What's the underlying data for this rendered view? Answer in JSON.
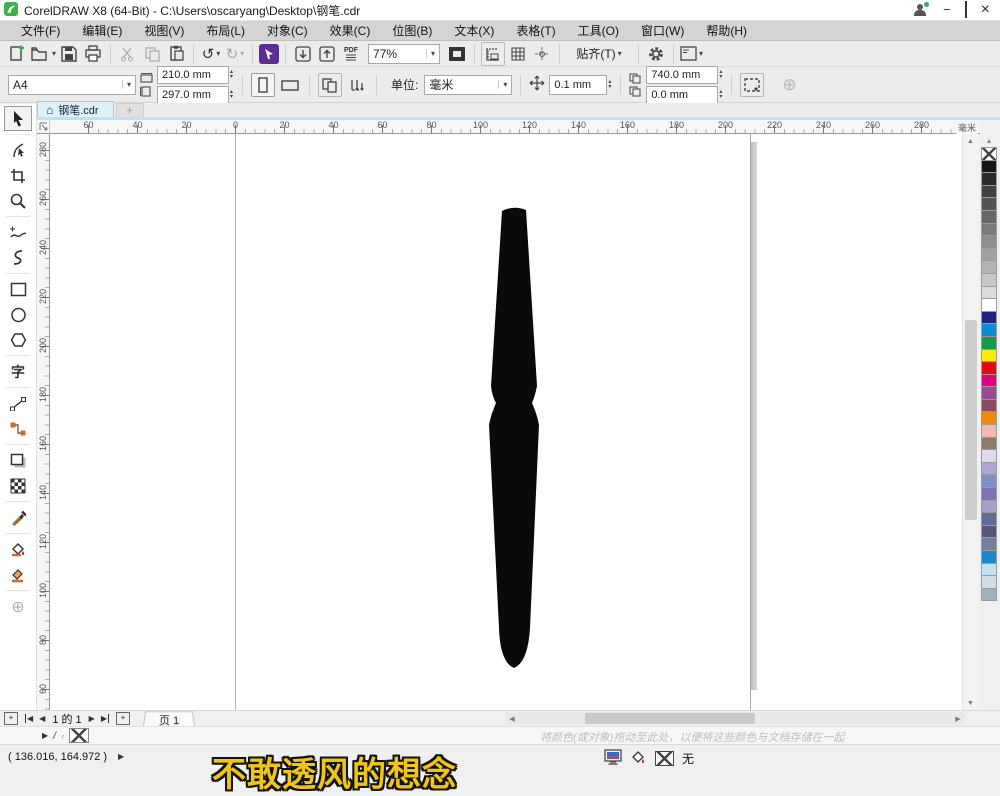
{
  "window": {
    "title": "CorelDRAW X8 (64-Bit) - C:\\Users\\oscaryang\\Desktop\\钢笔.cdr"
  },
  "icons": {
    "minimize": "−",
    "close": "×",
    "dropdown": "▾",
    "spin_up": "▴",
    "spin_down": "▾",
    "scroll_up": "▲",
    "scroll_down": "▼",
    "scroll_left": "◀",
    "scroll_right": "▶",
    "nav_prev": "◀",
    "nav_next": "▶",
    "tab_plus": "+",
    "page_add": "+",
    "import": "↓",
    "export": "↑",
    "undo": "↺",
    "redo": "↻",
    "customize_plus": "⊕",
    "home": "⌂",
    "flyout": "▶",
    "chevron_left": "‹"
  },
  "menubar": {
    "items": [
      "文件(F)",
      "编辑(E)",
      "视图(V)",
      "布局(L)",
      "对象(C)",
      "效果(C)",
      "位图(B)",
      "文本(X)",
      "表格(T)",
      "工具(O)",
      "窗口(W)",
      "帮助(H)"
    ]
  },
  "stdbar": {
    "zoom_value": "77%",
    "pdf_label": "PDF",
    "snap_label": "贴齐(T)"
  },
  "propbar": {
    "preset": "A4",
    "page_width": "210.0 mm",
    "page_height": "297.0 mm",
    "units_label": "单位:",
    "units_value": "毫米",
    "nudge_value": "0.1 mm",
    "dup_x": "740.0 mm",
    "dup_y": "0.0 mm"
  },
  "tabs": {
    "doc": "钢笔.cdr"
  },
  "rulers": {
    "h_labels": [
      "60",
      "40",
      "20",
      "0",
      "20",
      "40",
      "60",
      "80",
      "100",
      "120",
      "140",
      "160",
      "180",
      "200",
      "220",
      "240",
      "260",
      "280"
    ],
    "v_labels": [
      "280",
      "260",
      "240",
      "220",
      "200",
      "180",
      "160",
      "140",
      "120",
      "100",
      "80",
      "60"
    ],
    "unit": "毫米"
  },
  "toolbox": {
    "text_tool_glyph": "字"
  },
  "palette": {
    "colors": [
      "#161616",
      "#2d2a2a",
      "#434040",
      "#575353",
      "#6a6666",
      "#7d7a7a",
      "#908d8d",
      "#a3a0a0",
      "#b6b3b3",
      "#c9c7c7",
      "#dcdbdb",
      "#ffffff",
      "#20247e",
      "#0b8bd4",
      "#169b4e",
      "#f6eb0d",
      "#dd0c18",
      "#e2017d",
      "#9c4a8f",
      "#8c4a5e",
      "#f08a00",
      "#f6b8af",
      "#8b7c6f",
      "#dddcef",
      "#aba7d4",
      "#7f8ec5",
      "#7b74ba",
      "#a8a0ca",
      "#606c96",
      "#5a5474",
      "#76809d",
      "#1d87cf",
      "#c0e3f6",
      "#d0dde5",
      "#9fb1ba"
    ]
  },
  "pagenav": {
    "info": "1 的 1",
    "tab": "页 1"
  },
  "hints": {
    "drop_hint": "将颜色(或对象)拖动至此处，以便将这些颜色与文档存储在一起"
  },
  "statusbar": {
    "coords": "( 136.016, 164.972 )",
    "outline_none": "无"
  },
  "caption": {
    "text": "不敢透风的想念"
  }
}
